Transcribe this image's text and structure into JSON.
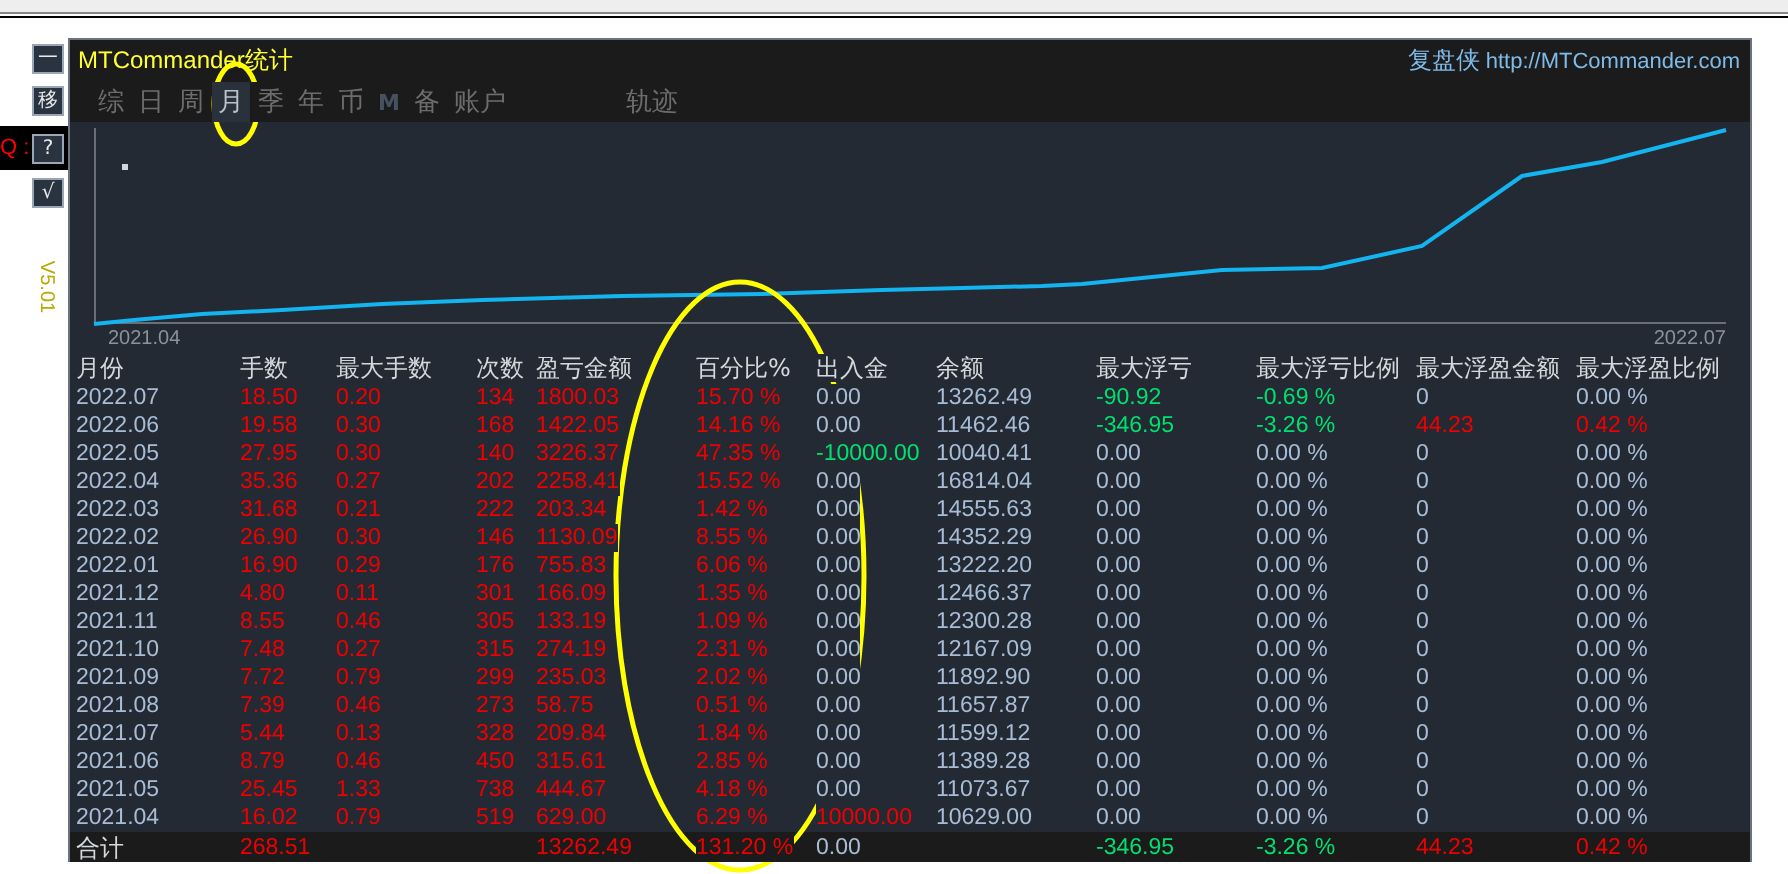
{
  "side_panel": {
    "buttons": [
      {
        "label": "一"
      },
      {
        "label": "移"
      },
      {
        "label": "?",
        "prompt": "Q :"
      },
      {
        "label": "√"
      }
    ],
    "version": "V5.01"
  },
  "window": {
    "title": "MTCommander统计",
    "brand": "复盘侠",
    "link": "http://MTCommander.com"
  },
  "tabs": [
    {
      "label": "综",
      "selected": false,
      "bold": false
    },
    {
      "label": "日",
      "selected": false,
      "bold": false
    },
    {
      "label": "周",
      "selected": false,
      "bold": false
    },
    {
      "label": "月",
      "selected": true,
      "bold": false
    },
    {
      "label": "季",
      "selected": false,
      "bold": false
    },
    {
      "label": "年",
      "selected": false,
      "bold": false
    },
    {
      "label": "币",
      "selected": false,
      "bold": false
    },
    {
      "label": "M",
      "selected": false,
      "bold": true
    },
    {
      "label": "备",
      "selected": false,
      "bold": false
    },
    {
      "label": "账户",
      "selected": false,
      "bold": false
    },
    {
      "label": "轨迹",
      "selected": false,
      "bold": false
    }
  ],
  "chart": {
    "x_start_label": "2021.04",
    "x_end_label": "2022.07"
  },
  "table": {
    "columns": [
      "月份",
      "手数",
      "最大手数",
      "次数",
      "盈亏金额",
      "百分比%",
      "出入金",
      "余额",
      "最大浮亏",
      "最大浮亏比例",
      "最大浮盈金额",
      "最大浮盈比例"
    ],
    "rows": [
      {
        "cells": [
          {
            "text": "2022.07",
            "kind": "plain"
          },
          {
            "text": "18.50",
            "kind": "up"
          },
          {
            "text": "0.20",
            "kind": "up"
          },
          {
            "text": "134",
            "kind": "up"
          },
          {
            "text": "1800.03",
            "kind": "up"
          },
          {
            "text": "15.70 %",
            "kind": "up"
          },
          {
            "text": "0.00",
            "kind": "plain"
          },
          {
            "text": "13262.49",
            "kind": "plain"
          },
          {
            "text": "-90.92",
            "kind": "down"
          },
          {
            "text": "-0.69 %",
            "kind": "down"
          },
          {
            "text": "0",
            "kind": "plain"
          },
          {
            "text": "0.00 %",
            "kind": "plain"
          }
        ]
      },
      {
        "cells": [
          {
            "text": "2022.06",
            "kind": "plain"
          },
          {
            "text": "19.58",
            "kind": "up"
          },
          {
            "text": "0.30",
            "kind": "up"
          },
          {
            "text": "168",
            "kind": "up"
          },
          {
            "text": "1422.05",
            "kind": "up"
          },
          {
            "text": "14.16 %",
            "kind": "up"
          },
          {
            "text": "0.00",
            "kind": "plain"
          },
          {
            "text": "11462.46",
            "kind": "plain"
          },
          {
            "text": "-346.95",
            "kind": "down"
          },
          {
            "text": "-3.26 %",
            "kind": "down"
          },
          {
            "text": "44.23",
            "kind": "up"
          },
          {
            "text": "0.42 %",
            "kind": "up"
          }
        ]
      },
      {
        "cells": [
          {
            "text": "2022.05",
            "kind": "plain"
          },
          {
            "text": "27.95",
            "kind": "up"
          },
          {
            "text": "0.30",
            "kind": "up"
          },
          {
            "text": "140",
            "kind": "up"
          },
          {
            "text": "3226.37",
            "kind": "up"
          },
          {
            "text": "47.35 %",
            "kind": "up"
          },
          {
            "text": "-10000.00",
            "kind": "down"
          },
          {
            "text": "10040.41",
            "kind": "plain"
          },
          {
            "text": "0.00",
            "kind": "plain"
          },
          {
            "text": "0.00 %",
            "kind": "plain"
          },
          {
            "text": "0",
            "kind": "plain"
          },
          {
            "text": "0.00 %",
            "kind": "plain"
          }
        ]
      },
      {
        "cells": [
          {
            "text": "2022.04",
            "kind": "plain"
          },
          {
            "text": "35.36",
            "kind": "up"
          },
          {
            "text": "0.27",
            "kind": "up"
          },
          {
            "text": "202",
            "kind": "up"
          },
          {
            "text": "2258.41",
            "kind": "up"
          },
          {
            "text": "15.52 %",
            "kind": "up"
          },
          {
            "text": "0.00",
            "kind": "plain"
          },
          {
            "text": "16814.04",
            "kind": "plain"
          },
          {
            "text": "0.00",
            "kind": "plain"
          },
          {
            "text": "0.00 %",
            "kind": "plain"
          },
          {
            "text": "0",
            "kind": "plain"
          },
          {
            "text": "0.00 %",
            "kind": "plain"
          }
        ]
      },
      {
        "cells": [
          {
            "text": "2022.03",
            "kind": "plain"
          },
          {
            "text": "31.68",
            "kind": "up"
          },
          {
            "text": "0.21",
            "kind": "up"
          },
          {
            "text": "222",
            "kind": "up"
          },
          {
            "text": "203.34",
            "kind": "up"
          },
          {
            "text": "1.42 %",
            "kind": "up"
          },
          {
            "text": "0.00",
            "kind": "plain"
          },
          {
            "text": "14555.63",
            "kind": "plain"
          },
          {
            "text": "0.00",
            "kind": "plain"
          },
          {
            "text": "0.00 %",
            "kind": "plain"
          },
          {
            "text": "0",
            "kind": "plain"
          },
          {
            "text": "0.00 %",
            "kind": "plain"
          }
        ]
      },
      {
        "cells": [
          {
            "text": "2022.02",
            "kind": "plain"
          },
          {
            "text": "26.90",
            "kind": "up"
          },
          {
            "text": "0.30",
            "kind": "up"
          },
          {
            "text": "146",
            "kind": "up"
          },
          {
            "text": "1130.09",
            "kind": "up"
          },
          {
            "text": "8.55 %",
            "kind": "up"
          },
          {
            "text": "0.00",
            "kind": "plain"
          },
          {
            "text": "14352.29",
            "kind": "plain"
          },
          {
            "text": "0.00",
            "kind": "plain"
          },
          {
            "text": "0.00 %",
            "kind": "plain"
          },
          {
            "text": "0",
            "kind": "plain"
          },
          {
            "text": "0.00 %",
            "kind": "plain"
          }
        ]
      },
      {
        "cells": [
          {
            "text": "2022.01",
            "kind": "plain"
          },
          {
            "text": "16.90",
            "kind": "up"
          },
          {
            "text": "0.29",
            "kind": "up"
          },
          {
            "text": "176",
            "kind": "up"
          },
          {
            "text": "755.83",
            "kind": "up"
          },
          {
            "text": "6.06 %",
            "kind": "up"
          },
          {
            "text": "0.00",
            "kind": "plain"
          },
          {
            "text": "13222.20",
            "kind": "plain"
          },
          {
            "text": "0.00",
            "kind": "plain"
          },
          {
            "text": "0.00 %",
            "kind": "plain"
          },
          {
            "text": "0",
            "kind": "plain"
          },
          {
            "text": "0.00 %",
            "kind": "plain"
          }
        ]
      },
      {
        "cells": [
          {
            "text": "2021.12",
            "kind": "plain"
          },
          {
            "text": "4.80",
            "kind": "up"
          },
          {
            "text": "0.11",
            "kind": "up"
          },
          {
            "text": "301",
            "kind": "up"
          },
          {
            "text": "166.09",
            "kind": "up"
          },
          {
            "text": "1.35 %",
            "kind": "up"
          },
          {
            "text": "0.00",
            "kind": "plain"
          },
          {
            "text": "12466.37",
            "kind": "plain"
          },
          {
            "text": "0.00",
            "kind": "plain"
          },
          {
            "text": "0.00 %",
            "kind": "plain"
          },
          {
            "text": "0",
            "kind": "plain"
          },
          {
            "text": "0.00 %",
            "kind": "plain"
          }
        ]
      },
      {
        "cells": [
          {
            "text": "2021.11",
            "kind": "plain"
          },
          {
            "text": "8.55",
            "kind": "up"
          },
          {
            "text": "0.46",
            "kind": "up"
          },
          {
            "text": "305",
            "kind": "up"
          },
          {
            "text": "133.19",
            "kind": "up"
          },
          {
            "text": "1.09 %",
            "kind": "up"
          },
          {
            "text": "0.00",
            "kind": "plain"
          },
          {
            "text": "12300.28",
            "kind": "plain"
          },
          {
            "text": "0.00",
            "kind": "plain"
          },
          {
            "text": "0.00 %",
            "kind": "plain"
          },
          {
            "text": "0",
            "kind": "plain"
          },
          {
            "text": "0.00 %",
            "kind": "plain"
          }
        ]
      },
      {
        "cells": [
          {
            "text": "2021.10",
            "kind": "plain"
          },
          {
            "text": "7.48",
            "kind": "up"
          },
          {
            "text": "0.27",
            "kind": "up"
          },
          {
            "text": "315",
            "kind": "up"
          },
          {
            "text": "274.19",
            "kind": "up"
          },
          {
            "text": "2.31 %",
            "kind": "up"
          },
          {
            "text": "0.00",
            "kind": "plain"
          },
          {
            "text": "12167.09",
            "kind": "plain"
          },
          {
            "text": "0.00",
            "kind": "plain"
          },
          {
            "text": "0.00 %",
            "kind": "plain"
          },
          {
            "text": "0",
            "kind": "plain"
          },
          {
            "text": "0.00 %",
            "kind": "plain"
          }
        ]
      },
      {
        "cells": [
          {
            "text": "2021.09",
            "kind": "plain"
          },
          {
            "text": "7.72",
            "kind": "up"
          },
          {
            "text": "0.79",
            "kind": "up"
          },
          {
            "text": "299",
            "kind": "up"
          },
          {
            "text": "235.03",
            "kind": "up"
          },
          {
            "text": "2.02 %",
            "kind": "up"
          },
          {
            "text": "0.00",
            "kind": "plain"
          },
          {
            "text": "11892.90",
            "kind": "plain"
          },
          {
            "text": "0.00",
            "kind": "plain"
          },
          {
            "text": "0.00 %",
            "kind": "plain"
          },
          {
            "text": "0",
            "kind": "plain"
          },
          {
            "text": "0.00 %",
            "kind": "plain"
          }
        ]
      },
      {
        "cells": [
          {
            "text": "2021.08",
            "kind": "plain"
          },
          {
            "text": "7.39",
            "kind": "up"
          },
          {
            "text": "0.46",
            "kind": "up"
          },
          {
            "text": "273",
            "kind": "up"
          },
          {
            "text": "58.75",
            "kind": "up"
          },
          {
            "text": "0.51 %",
            "kind": "up"
          },
          {
            "text": "0.00",
            "kind": "plain"
          },
          {
            "text": "11657.87",
            "kind": "plain"
          },
          {
            "text": "0.00",
            "kind": "plain"
          },
          {
            "text": "0.00 %",
            "kind": "plain"
          },
          {
            "text": "0",
            "kind": "plain"
          },
          {
            "text": "0.00 %",
            "kind": "plain"
          }
        ]
      },
      {
        "cells": [
          {
            "text": "2021.07",
            "kind": "plain"
          },
          {
            "text": "5.44",
            "kind": "up"
          },
          {
            "text": "0.13",
            "kind": "up"
          },
          {
            "text": "328",
            "kind": "up"
          },
          {
            "text": "209.84",
            "kind": "up"
          },
          {
            "text": "1.84 %",
            "kind": "up"
          },
          {
            "text": "0.00",
            "kind": "plain"
          },
          {
            "text": "11599.12",
            "kind": "plain"
          },
          {
            "text": "0.00",
            "kind": "plain"
          },
          {
            "text": "0.00 %",
            "kind": "plain"
          },
          {
            "text": "0",
            "kind": "plain"
          },
          {
            "text": "0.00 %",
            "kind": "plain"
          }
        ]
      },
      {
        "cells": [
          {
            "text": "2021.06",
            "kind": "plain"
          },
          {
            "text": "8.79",
            "kind": "up"
          },
          {
            "text": "0.46",
            "kind": "up"
          },
          {
            "text": "450",
            "kind": "up"
          },
          {
            "text": "315.61",
            "kind": "up"
          },
          {
            "text": "2.85 %",
            "kind": "up"
          },
          {
            "text": "0.00",
            "kind": "plain"
          },
          {
            "text": "11389.28",
            "kind": "plain"
          },
          {
            "text": "0.00",
            "kind": "plain"
          },
          {
            "text": "0.00 %",
            "kind": "plain"
          },
          {
            "text": "0",
            "kind": "plain"
          },
          {
            "text": "0.00 %",
            "kind": "plain"
          }
        ]
      },
      {
        "cells": [
          {
            "text": "2021.05",
            "kind": "plain"
          },
          {
            "text": "25.45",
            "kind": "up"
          },
          {
            "text": "1.33",
            "kind": "up"
          },
          {
            "text": "738",
            "kind": "up"
          },
          {
            "text": "444.67",
            "kind": "up"
          },
          {
            "text": "4.18 %",
            "kind": "up"
          },
          {
            "text": "0.00",
            "kind": "plain"
          },
          {
            "text": "11073.67",
            "kind": "plain"
          },
          {
            "text": "0.00",
            "kind": "plain"
          },
          {
            "text": "0.00 %",
            "kind": "plain"
          },
          {
            "text": "0",
            "kind": "plain"
          },
          {
            "text": "0.00 %",
            "kind": "plain"
          }
        ]
      },
      {
        "cells": [
          {
            "text": "2021.04",
            "kind": "plain"
          },
          {
            "text": "16.02",
            "kind": "up"
          },
          {
            "text": "0.79",
            "kind": "up"
          },
          {
            "text": "519",
            "kind": "up"
          },
          {
            "text": "629.00",
            "kind": "up"
          },
          {
            "text": "6.29 %",
            "kind": "up"
          },
          {
            "text": "10000.00",
            "kind": "up"
          },
          {
            "text": "10629.00",
            "kind": "plain"
          },
          {
            "text": "0.00",
            "kind": "plain"
          },
          {
            "text": "0.00 %",
            "kind": "plain"
          },
          {
            "text": "0",
            "kind": "plain"
          },
          {
            "text": "0.00 %",
            "kind": "plain"
          }
        ]
      }
    ],
    "total": {
      "cells": [
        {
          "text": "合计",
          "kind": "label"
        },
        {
          "text": "268.51",
          "kind": "up"
        },
        {
          "kind": "blank"
        },
        {
          "kind": "blank"
        },
        {
          "text": "13262.49",
          "kind": "up"
        },
        {
          "text": "131.20 %",
          "kind": "up"
        },
        {
          "text": "0.00",
          "kind": "plain"
        },
        {
          "kind": "blank"
        },
        {
          "text": "-346.95",
          "kind": "down"
        },
        {
          "text": "-3.26 %",
          "kind": "down"
        },
        {
          "text": "44.23",
          "kind": "up"
        },
        {
          "text": "0.42 %",
          "kind": "up"
        }
      ]
    }
  }
}
